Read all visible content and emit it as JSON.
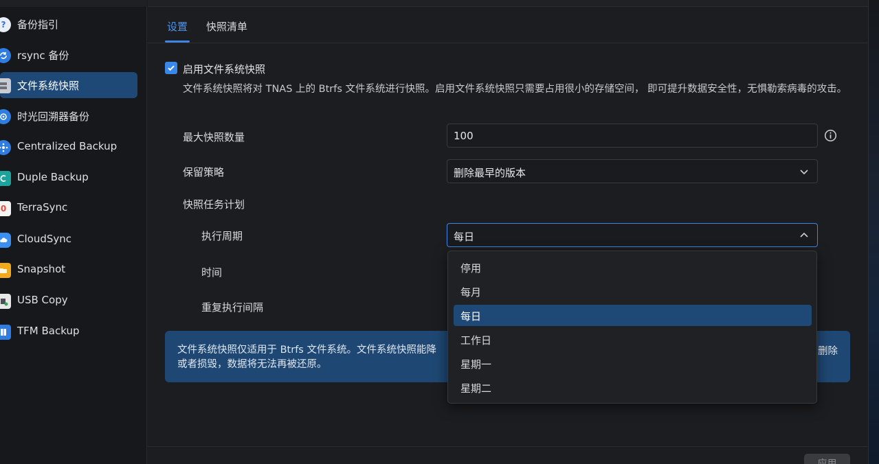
{
  "sidebar": {
    "items": [
      {
        "label": "备份指引",
        "icon": "question-icon",
        "color": "#3b82f6"
      },
      {
        "label": "rsync 备份",
        "icon": "sync-icon",
        "color": "#2f7de1"
      },
      {
        "label": "文件系统快照",
        "icon": "snapshot-drive-icon",
        "color": "#8a8f98",
        "active": true
      },
      {
        "label": "时光回溯器备份",
        "icon": "gear-clock-icon",
        "color": "#3b82f6"
      },
      {
        "label": "Centralized Backup",
        "icon": "network-hub-icon",
        "color": "#2f7de1"
      },
      {
        "label": "Duple Backup",
        "icon": "duple-icon",
        "color": "#1ba39c"
      },
      {
        "label": "TerraSync",
        "icon": "terrasync-icon",
        "color": "#e84b3c"
      },
      {
        "label": "CloudSync",
        "icon": "cloud-icon",
        "color": "#3b8ff0"
      },
      {
        "label": "Snapshot",
        "icon": "folder-icon",
        "color": "#f2a91d"
      },
      {
        "label": "USB Copy",
        "icon": "usb-icon",
        "color": "#5aa85a"
      },
      {
        "label": "TFM Backup",
        "icon": "book-icon",
        "color": "#3b82f6"
      }
    ]
  },
  "tabs": [
    {
      "label": "设置",
      "active": true
    },
    {
      "label": "快照清单",
      "active": false
    }
  ],
  "settings": {
    "enable_label": "启用文件系统快照",
    "enabled": true,
    "description": "文件系统快照将对 TNAS 上的 Btrfs 文件系统进行快照。启用文件系统快照只需要占用很小的存储空间， 即可提升数据安全性，无惧勒索病毒的攻击。",
    "max_label": "最大快照数量",
    "max_value": "100",
    "retention_label": "保留策略",
    "retention_value": "删除最早的版本",
    "schedule_label": "快照任务计划",
    "period_label": "执行周期",
    "period_value": "每日",
    "time_label": "时间",
    "interval_label": "重复执行间隔"
  },
  "notice": {
    "text_line1": "文件系统快照仅适用于 Btrfs 文件系统。文件系统快照能降",
    "text_line2": "或者损毁，数据将无法再被还原。",
    "text_tail": "删除"
  },
  "dropdown": {
    "options": [
      "停用",
      "每月",
      "每日",
      "工作日",
      "星期一",
      "星期二"
    ],
    "selected": "每日"
  },
  "footer": {
    "apply_label": "应用"
  },
  "colors": {
    "accent": "#3d86e6",
    "active_bg": "#1e4876"
  }
}
